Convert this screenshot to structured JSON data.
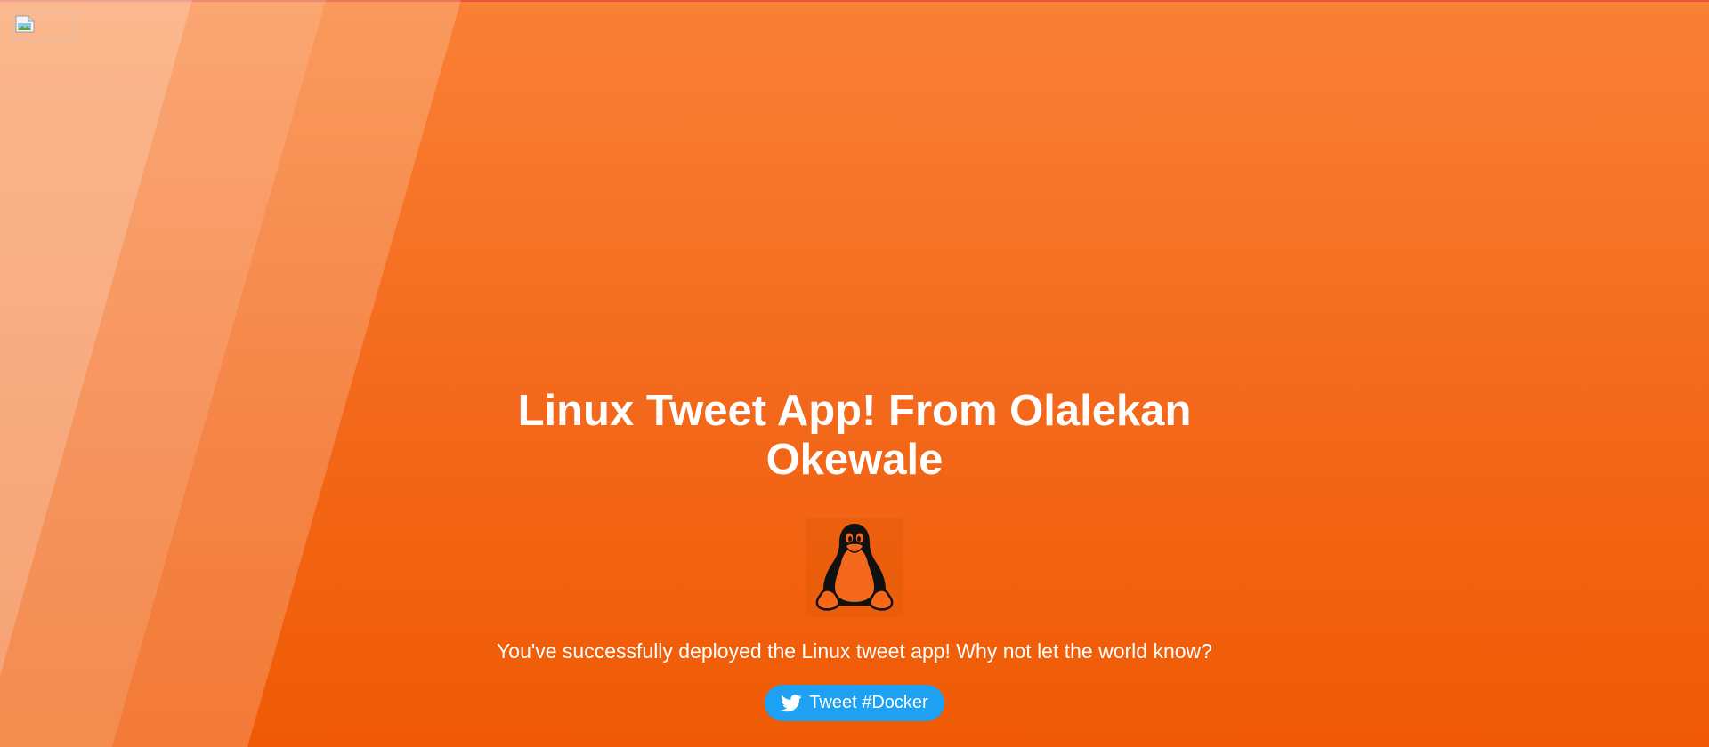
{
  "page": {
    "title": "Linux Tweet App! From Olalekan Okewale",
    "message": "You've successfully deployed the Linux tweet app! Why not let the world know?",
    "tweet_button_label": "Tweet #Docker"
  },
  "icons": {
    "logo": "broken-image-icon",
    "mascot": "tux-penguin-icon",
    "tweet": "twitter-bird-icon"
  },
  "colors": {
    "background_top": "#fa8035",
    "background_bottom": "#f05a04",
    "tweet_button": "#1da1f2",
    "text": "#ffffff"
  }
}
